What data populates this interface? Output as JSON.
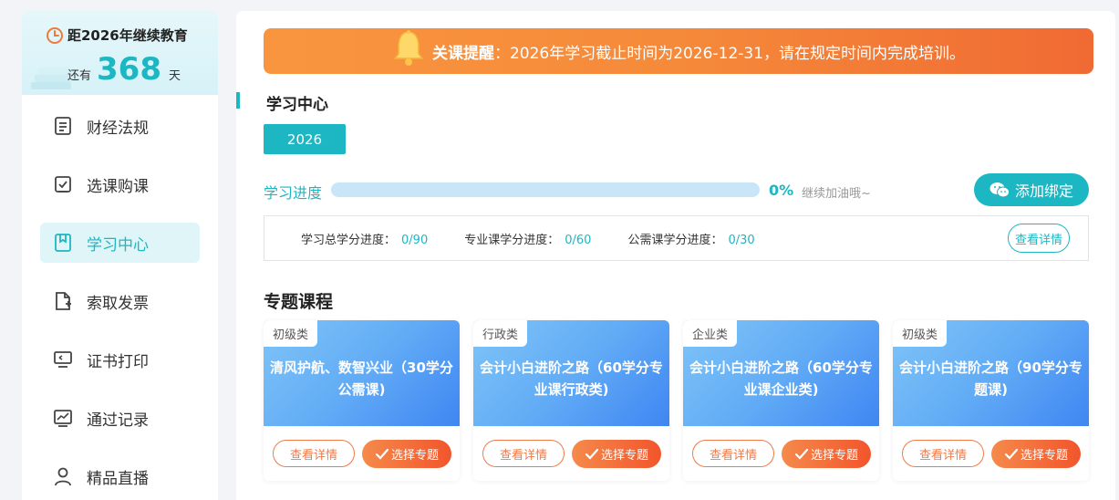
{
  "sidebar": {
    "countdown": {
      "title": "距2026年继续教育",
      "prefix": "还有",
      "days": "368",
      "suffix": "天"
    },
    "items": [
      {
        "label": "财经法规",
        "icon": "document-icon"
      },
      {
        "label": "选课购课",
        "icon": "checkbox-icon"
      },
      {
        "label": "学习中心",
        "icon": "bookmark-icon",
        "active": true
      },
      {
        "label": "索取发票",
        "icon": "invoice-add-icon"
      },
      {
        "label": "证书打印",
        "icon": "monitor-icon"
      },
      {
        "label": "通过记录",
        "icon": "chart-icon"
      },
      {
        "label": "精品直播",
        "icon": "user-icon"
      }
    ]
  },
  "notice": {
    "bold": "关课提醒",
    "text": "：2026年学习截止时间为2026-12-31，请在规定时间内完成培训。"
  },
  "study": {
    "title": "学习中心",
    "year_tab": "2026",
    "progress": {
      "label": "学习进度",
      "percent": "0%",
      "fraction": 0,
      "tip": "继续加油哦~"
    },
    "bind_label": "添加绑定",
    "credits": [
      {
        "label": "学习总学分进度：",
        "value": "0/90"
      },
      {
        "label": "专业课学分进度：",
        "value": "0/60"
      },
      {
        "label": "公需课学分进度：",
        "value": "0/30"
      }
    ],
    "detail_label": "查看详情"
  },
  "topics": {
    "title": "专题课程",
    "detail_label": "查看详情",
    "select_label": "选择专题",
    "cards": [
      {
        "tag": "初级类",
        "title": "清风护航、数智兴业（30学分公需课)"
      },
      {
        "tag": "行政类",
        "title": "会计小白进阶之路（60学分专业课行政类)"
      },
      {
        "tag": "企业类",
        "title": "会计小白进阶之路（60学分专业课企业类)"
      },
      {
        "tag": "初级类",
        "title": "会计小白进阶之路（90学分专题课)"
      }
    ]
  },
  "colors": {
    "accent": "#1cb7c3",
    "warning": "#f58a3a",
    "card_blue": "#62acf6"
  }
}
